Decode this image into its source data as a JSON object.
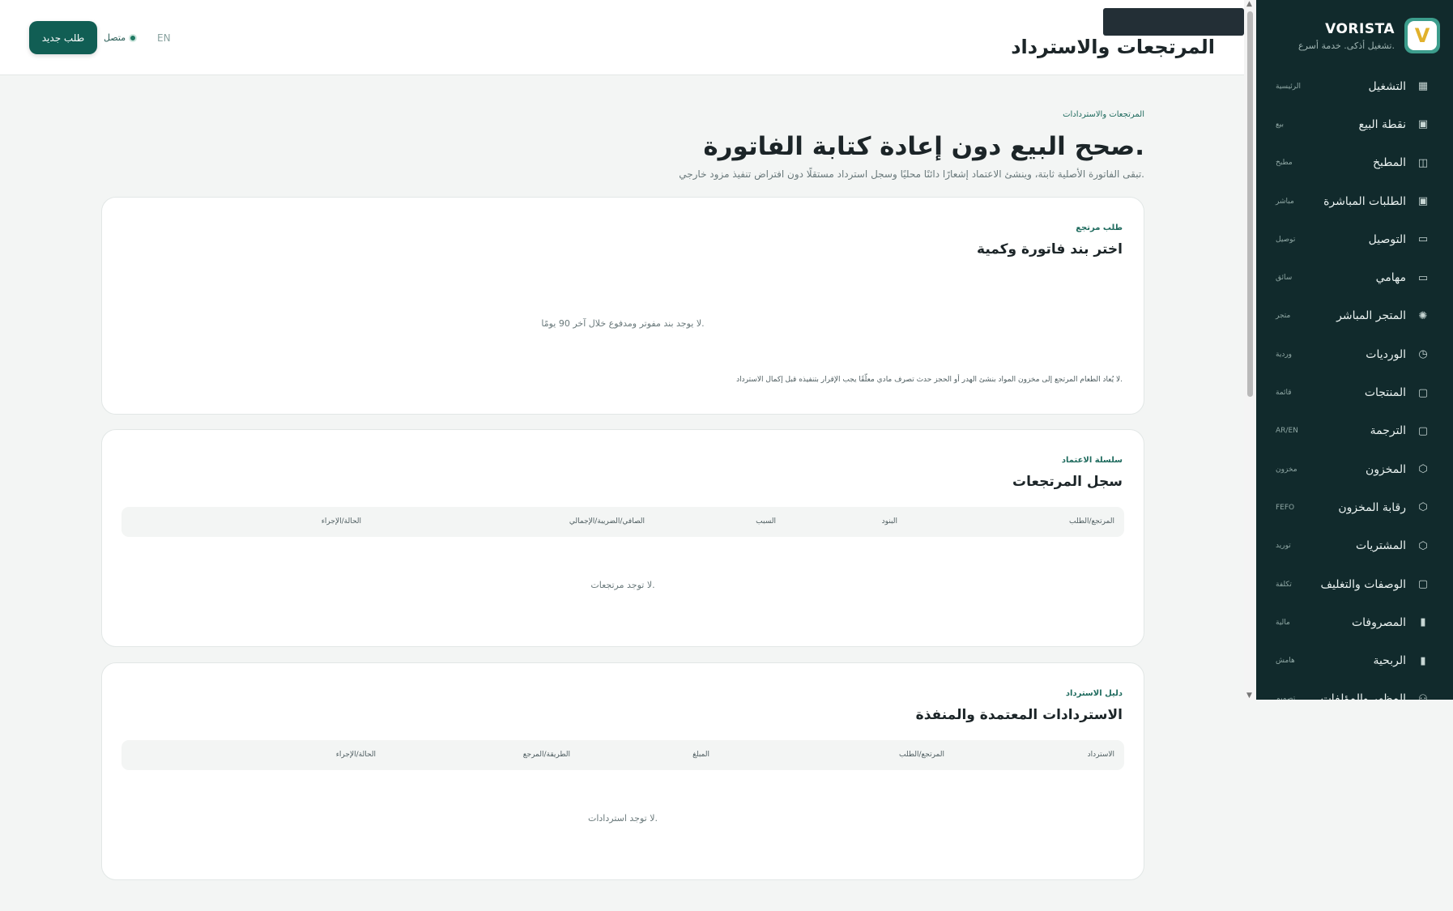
{
  "sidebar": {
    "brand_name": "VORISTA",
    "brand_tagline": "تشغيل أذكى. خدمة أسرع.",
    "logo_letter": "V",
    "items": [
      {
        "label": "التشغيل",
        "hint": "الرئيسية",
        "icon": "dashboard-icon"
      },
      {
        "label": "نقطة البيع",
        "hint": "بيع",
        "icon": "store-icon"
      },
      {
        "label": "المطبخ",
        "hint": "مطبخ",
        "icon": "bag-icon"
      },
      {
        "label": "الطلبات المباشرة",
        "hint": "مباشر",
        "icon": "store-icon"
      },
      {
        "label": "التوصيل",
        "hint": "توصيل",
        "icon": "monitor-icon"
      },
      {
        "label": "مهامي",
        "hint": "سائق",
        "icon": "monitor-icon"
      },
      {
        "label": "المتجر المباشر",
        "hint": "متجر",
        "icon": "sun-icon"
      },
      {
        "label": "الورديات",
        "hint": "وردية",
        "icon": "clock-icon"
      },
      {
        "label": "المنتجات",
        "hint": "قائمة",
        "icon": "clipboard-icon"
      },
      {
        "label": "الترجمة",
        "hint": "AR/EN",
        "icon": "clipboard-icon"
      },
      {
        "label": "المخزون",
        "hint": "مخزون",
        "icon": "box-icon"
      },
      {
        "label": "رقابة المخزون",
        "hint": "FEFO",
        "icon": "box-icon"
      },
      {
        "label": "المشتريات",
        "hint": "توريد",
        "icon": "box-icon"
      },
      {
        "label": "الوصفات والتغليف",
        "hint": "تكلفة",
        "icon": "clipboard-icon"
      },
      {
        "label": "المصروفات",
        "hint": "مالية",
        "icon": "bar-chart-icon"
      },
      {
        "label": "الربحية",
        "hint": "هامش",
        "icon": "bar-chart-icon"
      },
      {
        "label": "المظهر والمؤلفات",
        "hint": "تصميم",
        "icon": "users-icon"
      }
    ]
  },
  "topbar": {
    "title": "المرتجعات والاسترداد",
    "new_order_label": "طلب جديد",
    "status_label": "متصل",
    "language_label": "EN"
  },
  "hero": {
    "breadcrumb": "المرتجعات والاستردادات",
    "title": "صحح البيع دون إعادة كتابة الفاتورة.",
    "description": "تبقى الفاتورة الأصلية ثابتة، وينشئ الاعتماد إشعارًا دائنًا محليًا وسجل استرداد مستقلًا دون افتراض تنفيذ مزود خارجي."
  },
  "return_request": {
    "eyebrow": "طلب مرتجع",
    "title": "اختر بند فاتورة وكمية",
    "empty_text": "لا يوجد بند مفوتر ومدفوع خلال آخر 90 يومًا.",
    "note": "لا يُعاد الطعام المرتجع إلى مخزون المواد بنشئ الهدر أو الحجز حدث تصرف مادي معلّقًا يجب الإقرار بتنفيذه قبل إكمال الاسترداد."
  },
  "returns_log": {
    "eyebrow": "سلسلة الاعتماد",
    "title": "سجل المرتجعات",
    "columns": [
      "المرتجع/الطلب",
      "البنود",
      "السبب",
      "الصافي/الضريبة/الإجمالي",
      "الحالة/الإجراء"
    ],
    "empty_text": "لا توجد مرتجعات."
  },
  "refunds": {
    "eyebrow": "دليل الاسترداد",
    "title": "الاستردادات المعتمدة والمنفذة",
    "columns": [
      "الاسترداد",
      "المرتجع/الطلب",
      "المبلغ",
      "الطريقة/المرجع",
      "الحالة/الإجراء"
    ],
    "empty_text": "لا توجد استردادات."
  },
  "colors": {
    "sidebar_bg": "#112a2c",
    "accent": "#115e54",
    "logo_bg": "#3c9d8c"
  }
}
